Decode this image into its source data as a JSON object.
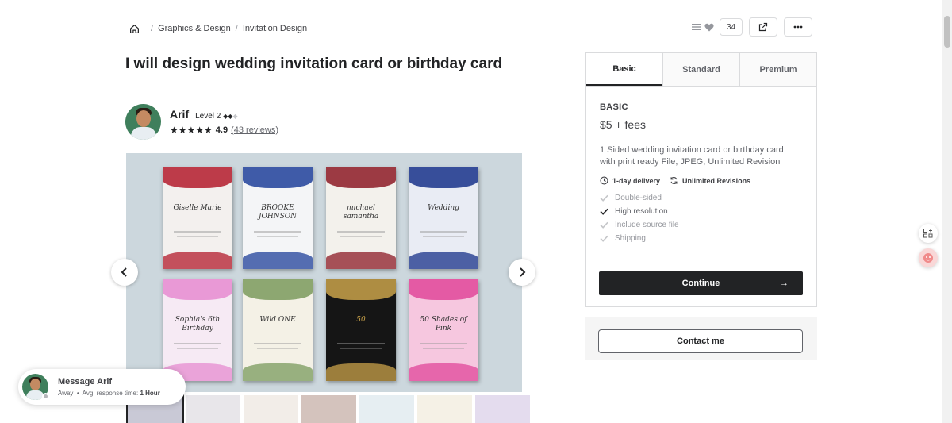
{
  "breadcrumb": {
    "items": [
      "Graphics & Design",
      "Invitation Design"
    ]
  },
  "actions": {
    "collect_count": "34"
  },
  "gig": {
    "title": "I will design wedding invitation card or birthday card"
  },
  "seller": {
    "name": "Arif",
    "level": "Level 2",
    "rating": "4.9",
    "reviews": "(43 reviews)"
  },
  "gallery": {
    "cards": [
      {
        "title": "Giselle Marie",
        "bg": "#f3f0ee",
        "accent": "#b31b2b"
      },
      {
        "title": "BROOKE JOHNSON",
        "bg": "#f4f5f7",
        "accent": "#1f3f9a"
      },
      {
        "title": "michael samantha",
        "bg": "#f3f1ec",
        "accent": "#8c1a26"
      },
      {
        "title": "Wedding",
        "bg": "#e9ecf4",
        "accent": "#17328a"
      },
      {
        "title": "Sophia's 6th Birthday",
        "bg": "#f6eaf4",
        "accent": "#e68bd0"
      },
      {
        "title": "Wild ONE",
        "bg": "#f4f1e6",
        "accent": "#7a9a5c"
      },
      {
        "title": "50",
        "bg": "#151515",
        "accent": "#c9a24a"
      },
      {
        "title": "50 Shades of Pink",
        "bg": "#f6c7df",
        "accent": "#e0469a"
      }
    ],
    "thumb_colors": [
      "#c9c9d6",
      "#e8e6ea",
      "#f2ede8",
      "#d4c3bd",
      "#e6eef2",
      "#f5f1e6",
      "#e4dcee"
    ]
  },
  "message": {
    "title": "Message Arif",
    "status": "Away",
    "response_label": "Avg. response time:",
    "response_time": "1 Hour"
  },
  "package": {
    "tabs": [
      "Basic",
      "Standard",
      "Premium"
    ],
    "active_tab": "Basic",
    "name": "BASIC",
    "price": "$5 + fees",
    "description": "1 Sided wedding invitation card or birthday card with print ready File, JPEG, Unlimited Revision",
    "delivery": "1-day delivery",
    "revisions": "Unlimited Revisions",
    "features": [
      {
        "label": "Double-sided",
        "included": false
      },
      {
        "label": "High resolution",
        "included": true
      },
      {
        "label": "Include source file",
        "included": false
      },
      {
        "label": "Shipping",
        "included": false
      }
    ],
    "continue_label": "Continue",
    "contact_label": "Contact me"
  },
  "colors": {
    "text_dark": "#222325",
    "muted": "#95979d",
    "border": "#dadbdd",
    "button_dark": "#222325",
    "gallery_bg": "#ccd7dd"
  }
}
